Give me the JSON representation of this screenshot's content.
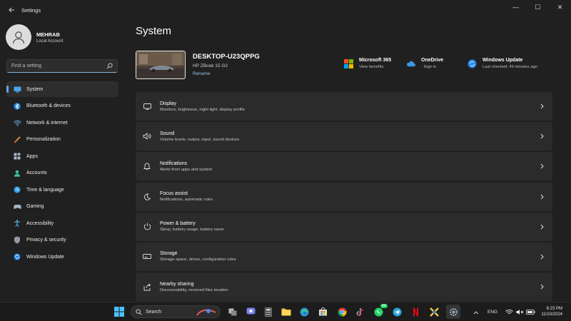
{
  "titlebar": {
    "app_title": "Settings",
    "minimize": "—",
    "maximize": "☐",
    "close": "✕"
  },
  "profile": {
    "name": "MEHRAB",
    "account_type": "Local Account"
  },
  "search": {
    "placeholder": "Find a setting"
  },
  "nav": [
    {
      "label": "System",
      "icon": "system-icon",
      "active": true
    },
    {
      "label": "Bluetooth & devices",
      "icon": "bluetooth-icon"
    },
    {
      "label": "Network & internet",
      "icon": "wifi-icon"
    },
    {
      "label": "Personalization",
      "icon": "brush-icon"
    },
    {
      "label": "Apps",
      "icon": "apps-icon"
    },
    {
      "label": "Accounts",
      "icon": "person-icon"
    },
    {
      "label": "Time & language",
      "icon": "globe-clock-icon"
    },
    {
      "label": "Gaming",
      "icon": "controller-icon"
    },
    {
      "label": "Accessibility",
      "icon": "accessibility-icon"
    },
    {
      "label": "Privacy & security",
      "icon": "shield-icon"
    },
    {
      "label": "Windows Update",
      "icon": "update-icon"
    }
  ],
  "page": {
    "title": "System"
  },
  "device": {
    "name": "DESKTOP-U23QPPG",
    "model": "HP ZBook 15 G2",
    "rename": "Rename"
  },
  "status": {
    "microsoft365": {
      "title": "Microsoft 365",
      "sub": "View benefits"
    },
    "onedrive": {
      "title": "OneDrive",
      "sub": "· Sign in"
    },
    "windows_update": {
      "title": "Windows Update",
      "sub": "Last checked: 49 minutes ago"
    }
  },
  "cards": [
    {
      "title": "Display",
      "sub": "Monitors, brightness, night light, display profile",
      "icon": "monitor-icon"
    },
    {
      "title": "Sound",
      "sub": "Volume levels, output, input, sound devices",
      "icon": "speaker-icon"
    },
    {
      "title": "Notifications",
      "sub": "Alerts from apps and system",
      "icon": "bell-icon"
    },
    {
      "title": "Focus assist",
      "sub": "Notifications, automatic rules",
      "icon": "moon-icon"
    },
    {
      "title": "Power & battery",
      "sub": "Sleep, battery usage, battery saver",
      "icon": "power-icon"
    },
    {
      "title": "Storage",
      "sub": "Storage space, drives, configuration rules",
      "icon": "storage-icon"
    },
    {
      "title": "Nearby sharing",
      "sub": "Discoverability, received files location",
      "icon": "share-icon"
    }
  ],
  "taskbar": {
    "search_label": "Search",
    "whatsapp_badge": "44",
    "language": "ENG",
    "time": "6:23 PM",
    "date": "11/10/2024"
  },
  "colors": {
    "accent": "#60a5e8",
    "card": "#2b2b2b",
    "background": "#202020"
  }
}
